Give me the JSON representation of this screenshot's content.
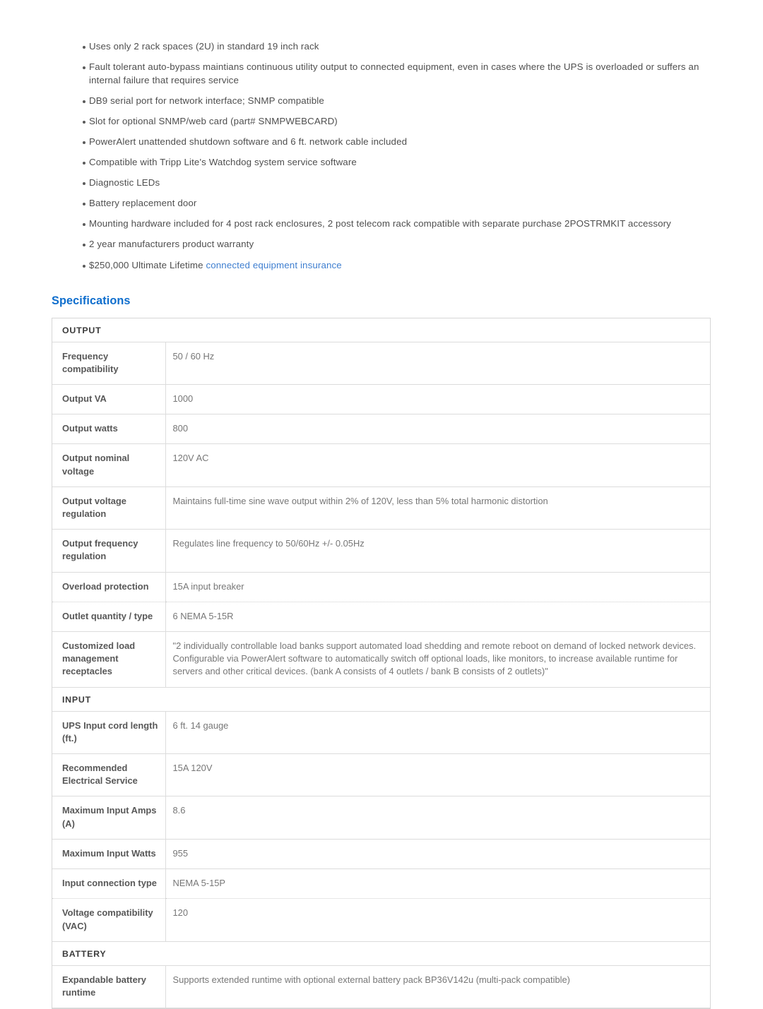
{
  "features": {
    "items": [
      {
        "text": "Uses only 2 rack spaces (2U) in standard 19 inch rack"
      },
      {
        "text": "Fault tolerant auto-bypass maintians continuous utility output to connected equipment, even in cases where the UPS is overloaded or suffers an internal failure that requires service"
      },
      {
        "text": "DB9 serial port for network interface; SNMP compatible"
      },
      {
        "text": "Slot for optional SNMP/web card (part# SNMPWEBCARD)"
      },
      {
        "text": "PowerAlert unattended shutdown software and 6 ft. network cable included"
      },
      {
        "text": "Compatible with Tripp Lite's Watchdog system service software"
      },
      {
        "text": "Diagnostic LEDs"
      },
      {
        "text": "Battery replacement door"
      },
      {
        "text": "Mounting hardware included for 4 post rack enclosures, 2 post telecom rack compatible with separate purchase 2POSTRMKIT accessory"
      },
      {
        "text": "2 year manufacturers product warranty"
      },
      {
        "text": "$250,000 Ultimate Lifetime ",
        "link_text": "connected equipment insurance"
      }
    ]
  },
  "specifications": {
    "heading": "Specifications",
    "sections": [
      {
        "title": "OUTPUT",
        "rows": [
          {
            "label": "Frequency compatibility",
            "value": "50 / 60 Hz",
            "border": "solid"
          },
          {
            "label": "Output VA",
            "value": "1000",
            "border": "solid"
          },
          {
            "label": "Output watts",
            "value": "800",
            "border": "solid"
          },
          {
            "label": "Output nominal voltage",
            "value": "120V AC",
            "border": "solid"
          },
          {
            "label": "Output voltage regulation",
            "value": "Maintains full-time sine wave output within 2% of 120V, less than 5% total harmonic distortion",
            "border": "solid"
          },
          {
            "label": "Output frequency regulation",
            "value": "Regulates line frequency to 50/60Hz +/- 0.05Hz",
            "border": "solid"
          },
          {
            "label": "Overload protection",
            "value": "15A input breaker",
            "border": "dotted"
          },
          {
            "label": "Outlet quantity / type",
            "value": "6 NEMA 5-15R",
            "border": "solid"
          },
          {
            "label": "Customized load management receptacles",
            "value": "\"2 individually controllable load banks support automated load shedding and remote reboot on demand of locked network devices. Configurable via PowerAlert software to automatically switch off optional loads, like monitors, to increase available runtime for servers and other critical devices. (bank A consists of 4 outlets / bank B consists of 2 outlets)\"",
            "border": "solid"
          }
        ]
      },
      {
        "title": "INPUT",
        "rows": [
          {
            "label": "UPS Input cord length (ft.)",
            "value": "6 ft. 14 gauge",
            "border": "solid"
          },
          {
            "label": "Recommended Electrical Service",
            "value": "15A 120V",
            "border": "solid"
          },
          {
            "label": "Maximum Input Amps (A)",
            "value": "8.6",
            "border": "solid"
          },
          {
            "label": "Maximum Input Watts",
            "value": "955",
            "border": "solid"
          },
          {
            "label": "Input connection type",
            "value": "NEMA 5-15P",
            "border": "dotted"
          },
          {
            "label": "Voltage compatibility (VAC)",
            "value": "120",
            "border": "solid"
          }
        ]
      },
      {
        "title": "BATTERY",
        "rows": [
          {
            "label": "Expandable battery runtime",
            "value": "Supports extended runtime with optional external battery pack BP36V142u (multi-pack compatible)",
            "border": "solid"
          }
        ]
      }
    ]
  },
  "colors": {
    "heading_blue": "#0f6ecd",
    "link_blue": "#3f7fd0",
    "label_gray": "#585858",
    "value_gray": "#777777",
    "border_gray": "#dcdcdc"
  }
}
